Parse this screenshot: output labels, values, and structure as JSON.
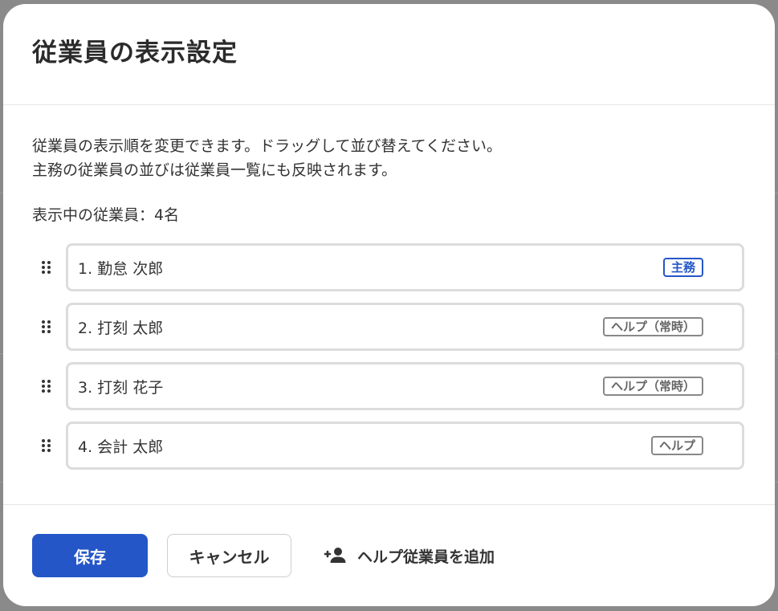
{
  "dialog": {
    "title": "従業員の表示設定",
    "description_line1": "従業員の表示順を変更できます。ドラッグして並び替えてください。",
    "description_line2": "主務の従業員の並びは従業員一覧にも反映されます。",
    "count_label": "表示中の従業員：4名"
  },
  "employees": [
    {
      "label": "1. 勤怠 次郎",
      "badge": "主務",
      "badge_type": "primary"
    },
    {
      "label": "2. 打刻 太郎",
      "badge": "ヘルプ（常時）",
      "badge_type": "help"
    },
    {
      "label": "3. 打刻 花子",
      "badge": "ヘルプ（常時）",
      "badge_type": "help"
    },
    {
      "label": "4. 会計 太郎",
      "badge": "ヘルプ",
      "badge_type": "help"
    }
  ],
  "footer": {
    "save_label": "保存",
    "cancel_label": "キャンセル",
    "add_help_label": "ヘルプ従業員を追加",
    "add_help_icon": "person-add-icon"
  },
  "colors": {
    "primary": "#2456c8",
    "help_badge": "#888888",
    "text": "#333333"
  }
}
